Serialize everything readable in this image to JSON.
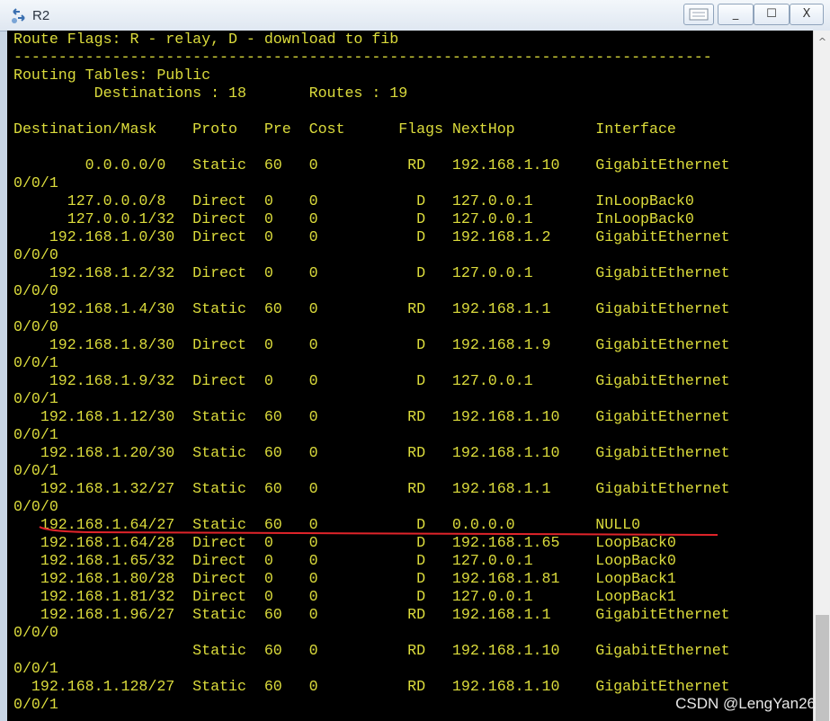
{
  "window": {
    "title": "R2",
    "app_icon": "router-icon",
    "controls": {
      "minimize": "_",
      "maximize": "☐",
      "close": "X"
    }
  },
  "terminal": {
    "lines": [
      "Route Flags: R - relay, D - download to fib",
      "------------------------------------------------------------------------------",
      "Routing Tables: Public",
      "         Destinations : 18       Routes : 19",
      "",
      "Destination/Mask    Proto   Pre  Cost      Flags NextHop         Interface",
      "",
      "        0.0.0.0/0   Static  60   0          RD   192.168.1.10    GigabitEthernet",
      "0/0/1",
      "      127.0.0.0/8   Direct  0    0           D   127.0.0.1       InLoopBack0",
      "      127.0.0.1/32  Direct  0    0           D   127.0.0.1       InLoopBack0",
      "    192.168.1.0/30  Direct  0    0           D   192.168.1.2     GigabitEthernet",
      "0/0/0",
      "    192.168.1.2/32  Direct  0    0           D   127.0.0.1       GigabitEthernet",
      "0/0/0",
      "    192.168.1.4/30  Static  60   0          RD   192.168.1.1     GigabitEthernet",
      "0/0/0",
      "    192.168.1.8/30  Direct  0    0           D   192.168.1.9     GigabitEthernet",
      "0/0/1",
      "    192.168.1.9/32  Direct  0    0           D   127.0.0.1       GigabitEthernet",
      "0/0/1",
      "   192.168.1.12/30  Static  60   0          RD   192.168.1.10    GigabitEthernet",
      "0/0/1",
      "   192.168.1.20/30  Static  60   0          RD   192.168.1.10    GigabitEthernet",
      "0/0/1",
      "   192.168.1.32/27  Static  60   0          RD   192.168.1.1     GigabitEthernet",
      "0/0/0",
      "   192.168.1.64/27  Static  60   0           D   0.0.0.0         NULL0",
      "   192.168.1.64/28  Direct  0    0           D   192.168.1.65    LoopBack0",
      "   192.168.1.65/32  Direct  0    0           D   127.0.0.1       LoopBack0",
      "   192.168.1.80/28  Direct  0    0           D   192.168.1.81    LoopBack1",
      "   192.168.1.81/32  Direct  0    0           D   127.0.0.1       LoopBack1",
      "   192.168.1.96/27  Static  60   0          RD   192.168.1.1     GigabitEthernet",
      "0/0/0",
      "                    Static  60   0          RD   192.168.1.10    GigabitEthernet",
      "0/0/1",
      "  192.168.1.128/27  Static  60   0          RD   192.168.1.10    GigabitEthernet",
      "0/0/1"
    ]
  },
  "scrollbar": {
    "up_arrow": "^"
  },
  "annotation": {
    "color": "#e0242a",
    "target_route": "192.168.1.64/27"
  },
  "watermark": "CSDN @LengYan26",
  "colors": {
    "terminal_text": "#dcdc3c",
    "terminal_bg": "#000000"
  }
}
